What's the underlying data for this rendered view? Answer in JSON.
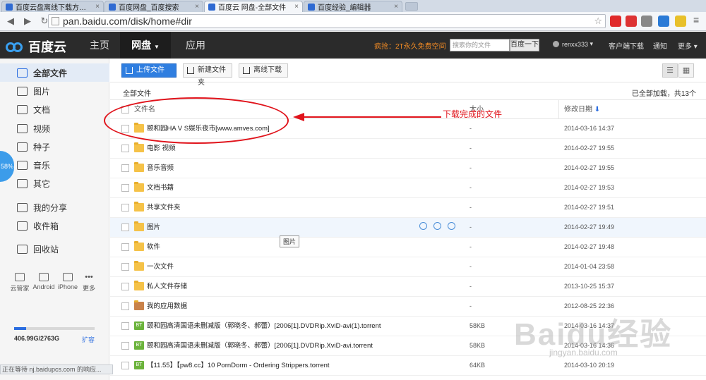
{
  "browser": {
    "tabs": [
      {
        "title": "百度云盘离线下载方法_百",
        "active": false
      },
      {
        "title": "百度网盘_百度搜索",
        "active": false
      },
      {
        "title": "百度云 网盘-全部文件",
        "active": true
      },
      {
        "title": "百度经验_编辑器",
        "active": false
      }
    ],
    "url": "pan.baidu.com/disk/home#dir",
    "status_text": "正在等待 nj.baidupcs.com 的响应..."
  },
  "header": {
    "logo": "百度云",
    "nav": [
      "主页",
      "网盘",
      "应用"
    ],
    "promo": "疯抢：2T永久免费空间",
    "search_placeholder": "搜索你的文件",
    "search_button": "百度一下",
    "username": "renxx333",
    "links": [
      "客户端下载",
      "通知",
      "更多"
    ]
  },
  "sidebar": {
    "items": [
      "全部文件",
      "图片",
      "文档",
      "视频",
      "种子",
      "音乐",
      "其它"
    ],
    "share_items": [
      "我的分享",
      "收件箱"
    ],
    "trash": "回收站",
    "progress": "58%",
    "devices": [
      "云管家",
      "Android",
      "iPhone",
      "更多"
    ],
    "quota_text": "406.99G/2763G",
    "quota_fraction": 0.147,
    "expand": "扩容"
  },
  "toolbar": {
    "upload": "上传文件",
    "new_folder": "新建文件夹",
    "offline": "离线下载"
  },
  "list": {
    "breadcrumb": "全部文件",
    "loaded_text": "已全部加载，共13个",
    "col_name": "文件名",
    "col_size": "大小",
    "col_date": "修改日期",
    "rows": [
      {
        "name": "颐和园HA V S娱乐夜市[www.amves.com]",
        "size": "-",
        "date": "2014-03-16 14:37",
        "type": "folder"
      },
      {
        "name": "电影 视频",
        "size": "-",
        "date": "2014-02-27 19:55",
        "type": "folder"
      },
      {
        "name": "音乐音频",
        "size": "-",
        "date": "2014-02-27 19:55",
        "type": "folder"
      },
      {
        "name": "文档书籍",
        "size": "-",
        "date": "2014-02-27 19:53",
        "type": "folder"
      },
      {
        "name": "共享文件夹",
        "size": "-",
        "date": "2014-02-27 19:51",
        "type": "folder"
      },
      {
        "name": "图片",
        "size": "-",
        "date": "2014-02-27 19:49",
        "type": "folder"
      },
      {
        "name": "软件",
        "size": "-",
        "date": "2014-02-27 19:48",
        "type": "folder"
      },
      {
        "name": "一次文件",
        "size": "-",
        "date": "2014-01-04 23:58",
        "type": "folder"
      },
      {
        "name": "私人文件存储",
        "size": "-",
        "date": "2013-10-25 15:37",
        "type": "folder"
      },
      {
        "name": "我的应用数据",
        "size": "-",
        "date": "2012-08-25 22:36",
        "type": "app"
      },
      {
        "name": "颐和园高清国语未删减版（郭晓冬、郝蕾）[2006[1].DVDRip.XviD-avi(1).torrent",
        "size": "58KB",
        "date": "2014-03-16 14:37",
        "type": "bt"
      },
      {
        "name": "颐和园高清国语未删减版（郭晓冬、郝蕾）[2006[1].DVDRip.XviD-avi.torrent",
        "size": "58KB",
        "date": "2014-03-16 14:36",
        "type": "bt"
      },
      {
        "name": "【11.55】【pw8.cc】10 PornDorm - Ordering Strippers.torrent",
        "size": "64KB",
        "date": "2014-03-10 20:19",
        "type": "bt"
      }
    ],
    "tooltip": "图片"
  },
  "annotation": {
    "text": "下载完成的文件"
  },
  "watermark": {
    "main": "Baidu经验",
    "sub": "jingyan.baidu.com"
  }
}
